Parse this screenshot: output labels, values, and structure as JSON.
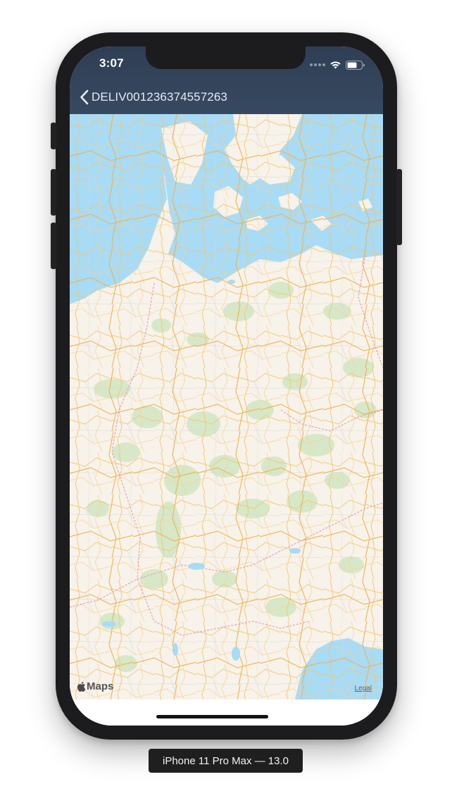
{
  "status_bar": {
    "time": "3:07"
  },
  "nav": {
    "back_title": "DELIV001236374557263"
  },
  "map": {
    "provider_label": "Maps",
    "legal_label": "Legal"
  },
  "device_caption": "iPhone 11 Pro Max — 13.0",
  "icons": [
    "back-chevron-icon",
    "wifi-icon",
    "battery-icon",
    "signal-icon",
    "apple-logo-icon"
  ],
  "colors": {
    "navbar": "#334155",
    "water": "#a8dbf5",
    "land": "#f7f2ea",
    "roads": "#f6c15a",
    "forest": "#d6e8c8"
  }
}
